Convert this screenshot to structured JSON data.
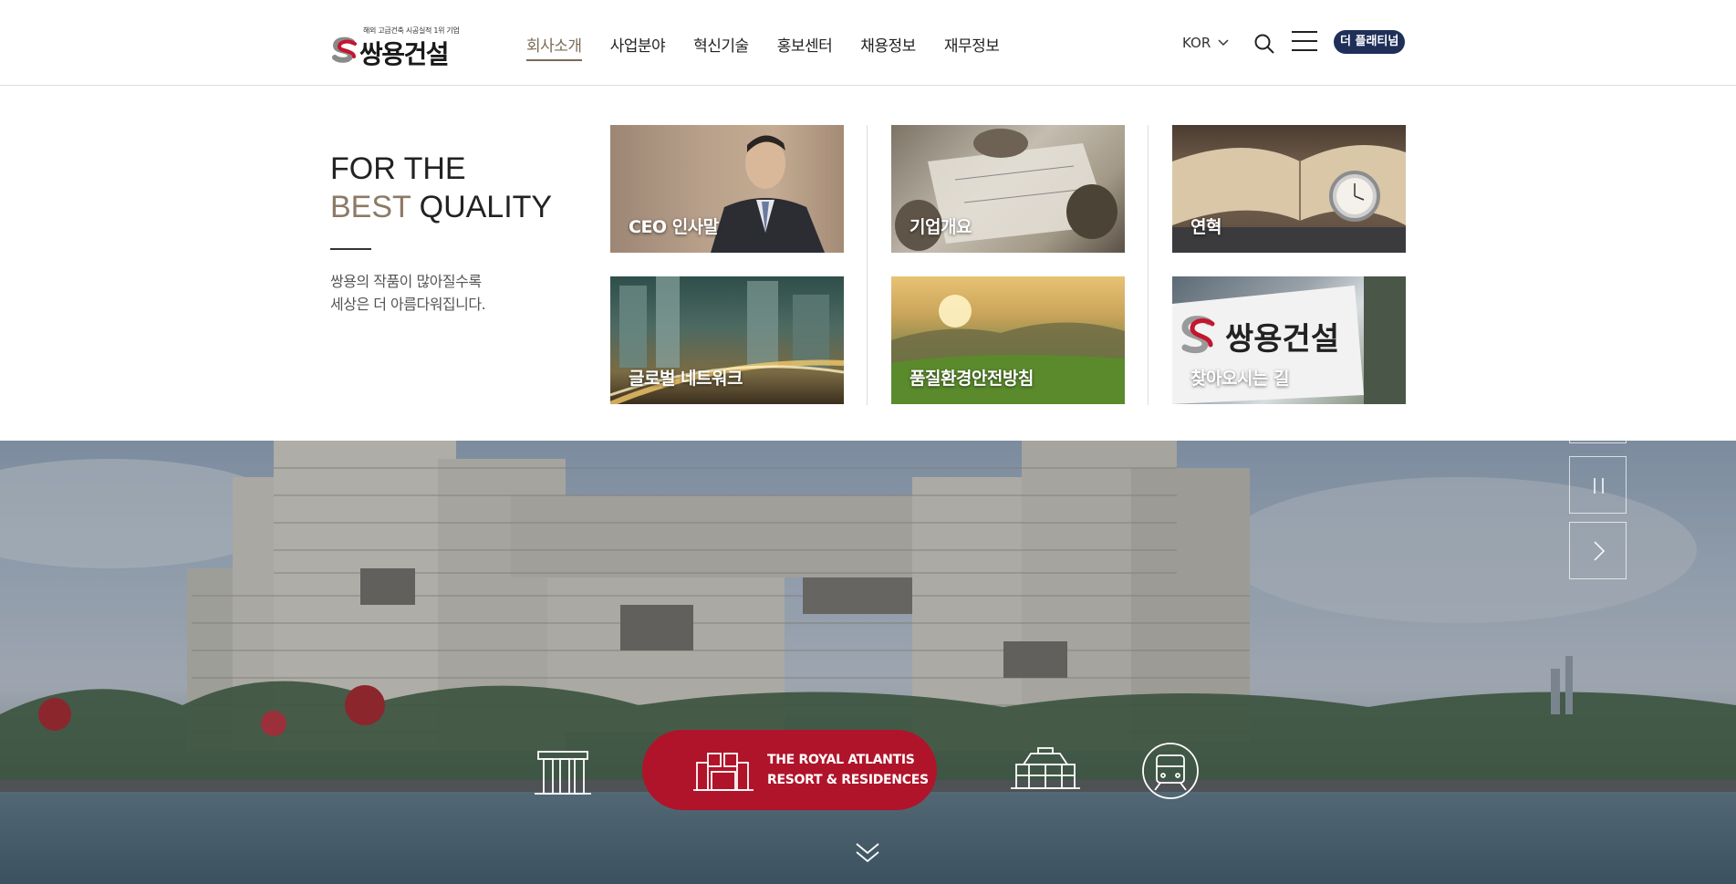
{
  "header": {
    "logo_tagline": "해외 고급건축 시공실적 1위 기업",
    "logo_text": "쌍용건설",
    "nav": [
      "회사소개",
      "사업분야",
      "혁신기술",
      "홍보센터",
      "채용정보",
      "재무정보"
    ],
    "language": "KOR",
    "platinum_label": "더 플래티넘"
  },
  "mega": {
    "title_line1": "FOR THE",
    "title_hl": "BEST",
    "title_rest": " QUALITY",
    "description": "쌍용의 작품이 많아질수록\n세상은 더 아름다워집니다.",
    "cards": [
      "CEO 인사말",
      "기업개요",
      "연혁",
      "글로벌 네트워크",
      "품질환경안전방침",
      "찾아오시는 길"
    ],
    "sign_text": "쌍용건설"
  },
  "hero": {
    "project_line1": "THE ROYAL ATLANTIS",
    "project_line2": "RESORT & RESIDENCES",
    "colors": {
      "accent": "#b0142a",
      "brand_navy": "#1f2f5a",
      "gold": "#8c7a66"
    }
  }
}
